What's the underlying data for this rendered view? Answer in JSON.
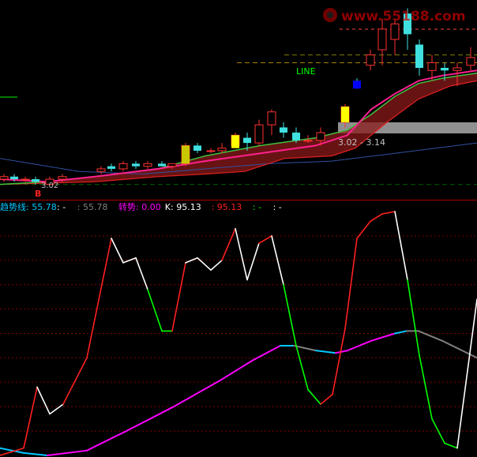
{
  "watermark": {
    "text": "www.55188.com",
    "color": "#cc0000"
  },
  "price_panel": {
    "line_label": "LINE",
    "range_label": "3.02 - 3.14",
    "low_label": "3.02",
    "b_marker": "B",
    "candles": [
      {
        "x": 5,
        "open": 3.02,
        "close": 3.03,
        "high": 3.04,
        "low": 3.01
      },
      {
        "x": 18,
        "open": 3.03,
        "close": 3.02,
        "high": 3.04,
        "low": 3.01
      },
      {
        "x": 32,
        "open": 3.02,
        "close": 3.02,
        "high": 3.03,
        "low": 3.01
      },
      {
        "x": 45,
        "open": 3.02,
        "close": 3.01,
        "high": 3.03,
        "low": 3.0
      },
      {
        "x": 63,
        "open": 3.0,
        "close": 3.02,
        "high": 3.03,
        "low": 3.0
      },
      {
        "x": 79,
        "open": 3.02,
        "close": 3.03,
        "high": 3.04,
        "low": 3.01
      },
      {
        "x": 128,
        "open": 3.05,
        "close": 3.06,
        "high": 3.07,
        "low": 3.04
      },
      {
        "x": 141,
        "open": 3.07,
        "close": 3.06,
        "high": 3.08,
        "low": 3.05
      },
      {
        "x": 156,
        "open": 3.06,
        "close": 3.08,
        "high": 3.09,
        "low": 3.05
      },
      {
        "x": 172,
        "open": 3.08,
        "close": 3.07,
        "high": 3.09,
        "low": 3.06
      },
      {
        "x": 187,
        "open": 3.07,
        "close": 3.08,
        "high": 3.09,
        "low": 3.06
      },
      {
        "x": 205,
        "open": 3.08,
        "close": 3.07,
        "high": 3.09,
        "low": 3.07
      },
      {
        "x": 218,
        "open": 3.07,
        "close": 3.08,
        "high": 3.08,
        "low": 3.06
      },
      {
        "x": 235,
        "open": 3.08,
        "close": 3.15,
        "high": 3.16,
        "low": 3.07
      },
      {
        "x": 250,
        "open": 3.15,
        "close": 3.13,
        "high": 3.16,
        "low": 3.12
      },
      {
        "x": 267,
        "open": 3.13,
        "close": 3.13,
        "high": 3.14,
        "low": 3.12
      },
      {
        "x": 281,
        "open": 3.13,
        "close": 3.14,
        "high": 3.16,
        "low": 3.12
      },
      {
        "x": 298,
        "open": 3.15,
        "close": 3.19,
        "high": 3.2,
        "low": 3.14
      },
      {
        "x": 313,
        "open": 3.18,
        "close": 3.16,
        "high": 3.2,
        "low": 3.13
      },
      {
        "x": 328,
        "open": 3.16,
        "close": 3.23,
        "high": 3.25,
        "low": 3.15
      },
      {
        "x": 344,
        "open": 3.23,
        "close": 3.28,
        "high": 3.29,
        "low": 3.19
      },
      {
        "x": 359,
        "open": 3.22,
        "close": 3.2,
        "high": 3.24,
        "low": 3.18
      },
      {
        "x": 375,
        "open": 3.2,
        "close": 3.17,
        "high": 3.22,
        "low": 3.16
      },
      {
        "x": 390,
        "open": 3.17,
        "close": 3.17,
        "high": 3.19,
        "low": 3.16
      },
      {
        "x": 406,
        "open": 3.17,
        "close": 3.2,
        "high": 3.22,
        "low": 3.15
      },
      {
        "x": 437,
        "open": 3.24,
        "close": 3.3,
        "high": 3.31,
        "low": 3.22
      },
      {
        "x": 452,
        "open": 3.4,
        "close": 3.38,
        "high": 3.41,
        "low": 3.37
      },
      {
        "x": 469,
        "open": 3.46,
        "close": 3.5,
        "high": 3.52,
        "low": 3.44
      },
      {
        "x": 484,
        "open": 3.52,
        "close": 3.6,
        "high": 3.64,
        "low": 3.46
      },
      {
        "x": 500,
        "open": 3.56,
        "close": 3.62,
        "high": 3.64,
        "low": 3.5
      },
      {
        "x": 516,
        "open": 3.66,
        "close": 3.58,
        "high": 3.68,
        "low": 3.52
      },
      {
        "x": 531,
        "open": 3.54,
        "close": 3.45,
        "high": 3.56,
        "low": 3.42
      },
      {
        "x": 547,
        "open": 3.44,
        "close": 3.47,
        "high": 3.5,
        "low": 3.4
      },
      {
        "x": 563,
        "open": 3.45,
        "close": 3.44,
        "high": 3.47,
        "low": 3.4
      },
      {
        "x": 579,
        "open": 3.44,
        "close": 3.45,
        "high": 3.47,
        "low": 3.38
      },
      {
        "x": 596,
        "open": 3.46,
        "close": 3.49,
        "high": 3.53,
        "low": 3.44
      }
    ],
    "magenta_line": [
      [
        0,
        3.02
      ],
      [
        60,
        3.01
      ],
      [
        120,
        3.03
      ],
      [
        200,
        3.06
      ],
      [
        260,
        3.09
      ],
      [
        330,
        3.12
      ],
      [
        400,
        3.15
      ],
      [
        440,
        3.19
      ],
      [
        470,
        3.29
      ],
      [
        500,
        3.35
      ],
      [
        530,
        3.4
      ],
      [
        560,
        3.42
      ],
      [
        604,
        3.44
      ]
    ],
    "green_line": [
      [
        0,
        3.0
      ],
      [
        60,
        3.01
      ],
      [
        120,
        3.03
      ],
      [
        200,
        3.06
      ],
      [
        260,
        3.11
      ],
      [
        330,
        3.15
      ],
      [
        400,
        3.18
      ],
      [
        440,
        3.21
      ],
      [
        470,
        3.27
      ],
      [
        500,
        3.34
      ],
      [
        530,
        3.39
      ],
      [
        560,
        3.41
      ],
      [
        604,
        3.43
      ]
    ],
    "red_line": [
      [
        0,
        3.0
      ],
      [
        120,
        3.01
      ],
      [
        200,
        3.03
      ],
      [
        260,
        3.04
      ],
      [
        310,
        3.05
      ],
      [
        360,
        3.1
      ],
      [
        420,
        3.11
      ],
      [
        450,
        3.14
      ],
      [
        490,
        3.24
      ],
      [
        530,
        3.33
      ],
      [
        570,
        3.38
      ],
      [
        604,
        3.4
      ]
    ],
    "navy_line": [
      [
        0,
        3.1
      ],
      [
        100,
        3.05
      ],
      [
        180,
        3.04
      ],
      [
        260,
        3.06
      ],
      [
        340,
        3.08
      ],
      [
        420,
        3.09
      ],
      [
        500,
        3.12
      ],
      [
        604,
        3.16
      ]
    ]
  },
  "indicator_panel": {
    "legend": [
      {
        "text": "趋势线: 55.78",
        "color": "#00c8ff"
      },
      {
        "text": ": -",
        "color": "#ffffff"
      },
      {
        "text": ": 55.78",
        "color": "#808080"
      },
      {
        "text": "转势: 0.00",
        "color": "#ff00ff"
      },
      {
        "text": "K: 95.13",
        "color": "#ffffff"
      },
      {
        "text": ": 95.13",
        "color": "#ff2020"
      },
      {
        "text": ": -",
        "color": "#00ff00"
      },
      {
        "text": ": -",
        "color": "#ffffff"
      }
    ],
    "ylim": [
      0,
      100
    ],
    "k_line": [
      {
        "x": 0,
        "y": 0,
        "color": "#ffffff"
      },
      {
        "x": 30,
        "y": 3,
        "color": "#ff2020"
      },
      {
        "x": 47,
        "y": 28,
        "color": "#ff2020"
      },
      {
        "x": 63,
        "y": 17,
        "color": "#ffffff"
      },
      {
        "x": 80,
        "y": 21,
        "color": "#ffffff"
      },
      {
        "x": 110,
        "y": 40,
        "color": "#ff2020"
      },
      {
        "x": 141,
        "y": 89,
        "color": "#ff2020"
      },
      {
        "x": 156,
        "y": 79,
        "color": "#ffffff"
      },
      {
        "x": 172,
        "y": 81,
        "color": "#ffffff"
      },
      {
        "x": 187,
        "y": 68,
        "color": "#ffffff"
      },
      {
        "x": 205,
        "y": 51,
        "color": "#00ff00"
      },
      {
        "x": 218,
        "y": 51,
        "color": "#00ff00"
      },
      {
        "x": 235,
        "y": 79,
        "color": "#ff2020"
      },
      {
        "x": 250,
        "y": 81,
        "color": "#ffffff"
      },
      {
        "x": 267,
        "y": 76,
        "color": "#ffffff"
      },
      {
        "x": 281,
        "y": 80,
        "color": "#ffffff"
      },
      {
        "x": 298,
        "y": 93,
        "color": "#ff2020"
      },
      {
        "x": 313,
        "y": 72,
        "color": "#ffffff"
      },
      {
        "x": 328,
        "y": 87,
        "color": "#ffffff"
      },
      {
        "x": 344,
        "y": 90,
        "color": "#ff2020"
      },
      {
        "x": 359,
        "y": 70,
        "color": "#ffffff"
      },
      {
        "x": 375,
        "y": 45,
        "color": "#00ff00"
      },
      {
        "x": 390,
        "y": 27,
        "color": "#00ff00"
      },
      {
        "x": 406,
        "y": 21,
        "color": "#00ff00"
      },
      {
        "x": 421,
        "y": 25,
        "color": "#ff2020"
      },
      {
        "x": 437,
        "y": 52,
        "color": "#ff2020"
      },
      {
        "x": 452,
        "y": 89,
        "color": "#ff2020"
      },
      {
        "x": 469,
        "y": 96,
        "color": "#ff2020"
      },
      {
        "x": 484,
        "y": 99,
        "color": "#ff2020"
      },
      {
        "x": 500,
        "y": 105,
        "color": "#ff2020"
      },
      {
        "x": 516,
        "y": 72,
        "color": "#ffffff"
      },
      {
        "x": 531,
        "y": 41,
        "color": "#00ff00"
      },
      {
        "x": 547,
        "y": 15,
        "color": "#00ff00"
      },
      {
        "x": 563,
        "y": 5,
        "color": "#00ff00"
      },
      {
        "x": 579,
        "y": 3,
        "color": "#00ff00"
      },
      {
        "x": 604,
        "y": 64,
        "color": "#ffffff"
      }
    ],
    "trend_line": [
      {
        "x": 0,
        "y": 3,
        "color": "#00c8ff"
      },
      {
        "x": 30,
        "y": 1,
        "color": "#00c8ff"
      },
      {
        "x": 60,
        "y": 0,
        "color": "#00c8ff"
      },
      {
        "x": 110,
        "y": 2,
        "color": "#ff00ff"
      },
      {
        "x": 160,
        "y": 10,
        "color": "#ff00ff"
      },
      {
        "x": 220,
        "y": 20,
        "color": "#ff00ff"
      },
      {
        "x": 280,
        "y": 31,
        "color": "#ff00ff"
      },
      {
        "x": 320,
        "y": 39,
        "color": "#ff00ff"
      },
      {
        "x": 355,
        "y": 45,
        "color": "#ff00ff"
      },
      {
        "x": 372,
        "y": 45,
        "color": "#00c8ff"
      },
      {
        "x": 400,
        "y": 43,
        "color": "#808080"
      },
      {
        "x": 425,
        "y": 42,
        "color": "#00c8ff"
      },
      {
        "x": 440,
        "y": 43,
        "color": "#ff00ff"
      },
      {
        "x": 470,
        "y": 47,
        "color": "#ff00ff"
      },
      {
        "x": 500,
        "y": 50,
        "color": "#ff00ff"
      },
      {
        "x": 515,
        "y": 51,
        "color": "#00c8ff"
      },
      {
        "x": 530,
        "y": 51,
        "color": "#808080"
      },
      {
        "x": 560,
        "y": 47,
        "color": "#808080"
      },
      {
        "x": 604,
        "y": 40,
        "color": "#808080"
      }
    ]
  },
  "chart_data": {
    "type": "line",
    "title": "",
    "series": [
      {
        "name": "K",
        "values": [
          0,
          3,
          28,
          17,
          21,
          40,
          89,
          79,
          81,
          68,
          51,
          51,
          79,
          81,
          76,
          80,
          93,
          72,
          87,
          90,
          70,
          45,
          27,
          21,
          25,
          52,
          89,
          96,
          99,
          100,
          72,
          41,
          15,
          5,
          3,
          64
        ]
      },
      {
        "name": "趋势线",
        "values": [
          3,
          1,
          0,
          2,
          10,
          20,
          31,
          39,
          45,
          45,
          43,
          42,
          43,
          47,
          50,
          51,
          51,
          47,
          40
        ]
      }
    ],
    "ylim": [
      0,
      100
    ]
  }
}
